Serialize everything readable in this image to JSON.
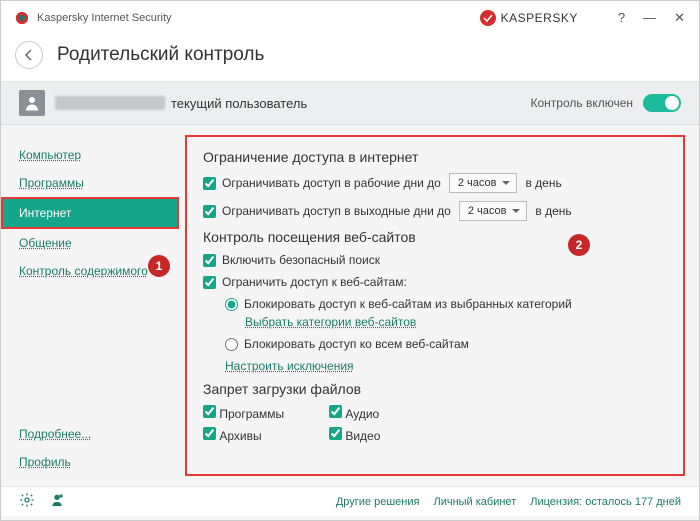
{
  "app_title": "Kaspersky Internet Security",
  "brand": "KASPERSKY",
  "page_title": "Родительский контроль",
  "userbar": {
    "current_label": "текущий пользователь",
    "control_label": "Контроль включен"
  },
  "sidebar": {
    "items": [
      {
        "label": "Компьютер"
      },
      {
        "label": "Программы"
      },
      {
        "label": "Интернет"
      },
      {
        "label": "Общение"
      },
      {
        "label": "Контроль содержимого"
      }
    ],
    "more": "Подробнее...",
    "profile": "Профиль"
  },
  "badges": {
    "one": "1",
    "two": "2"
  },
  "section1": {
    "title": "Ограничение доступа в интернет",
    "weekday": "Ограничивать доступ в рабочие дни до",
    "weekend": "Ограничивать доступ в выходные дни до",
    "hours": "2 часов",
    "perday": "в день"
  },
  "section2": {
    "title": "Контроль посещения веб-сайтов",
    "safe_search": "Включить безопасный поиск",
    "limit_sites": "Ограничить доступ к веб-сайтам:",
    "block_categories": "Блокировать доступ к веб-сайтам из выбранных категорий",
    "choose_categories": "Выбрать категории веб-сайтов",
    "block_all": "Блокировать доступ ко всем веб-сайтам",
    "exceptions": "Настроить исключения"
  },
  "section3": {
    "title": "Запрет загрузки файлов",
    "programs": "Программы",
    "audio": "Аудио",
    "archives": "Архивы",
    "video": "Видео"
  },
  "footer": {
    "other": "Другие решения",
    "account": "Личный кабинет",
    "license": "Лицензия: осталось 177 дней"
  }
}
